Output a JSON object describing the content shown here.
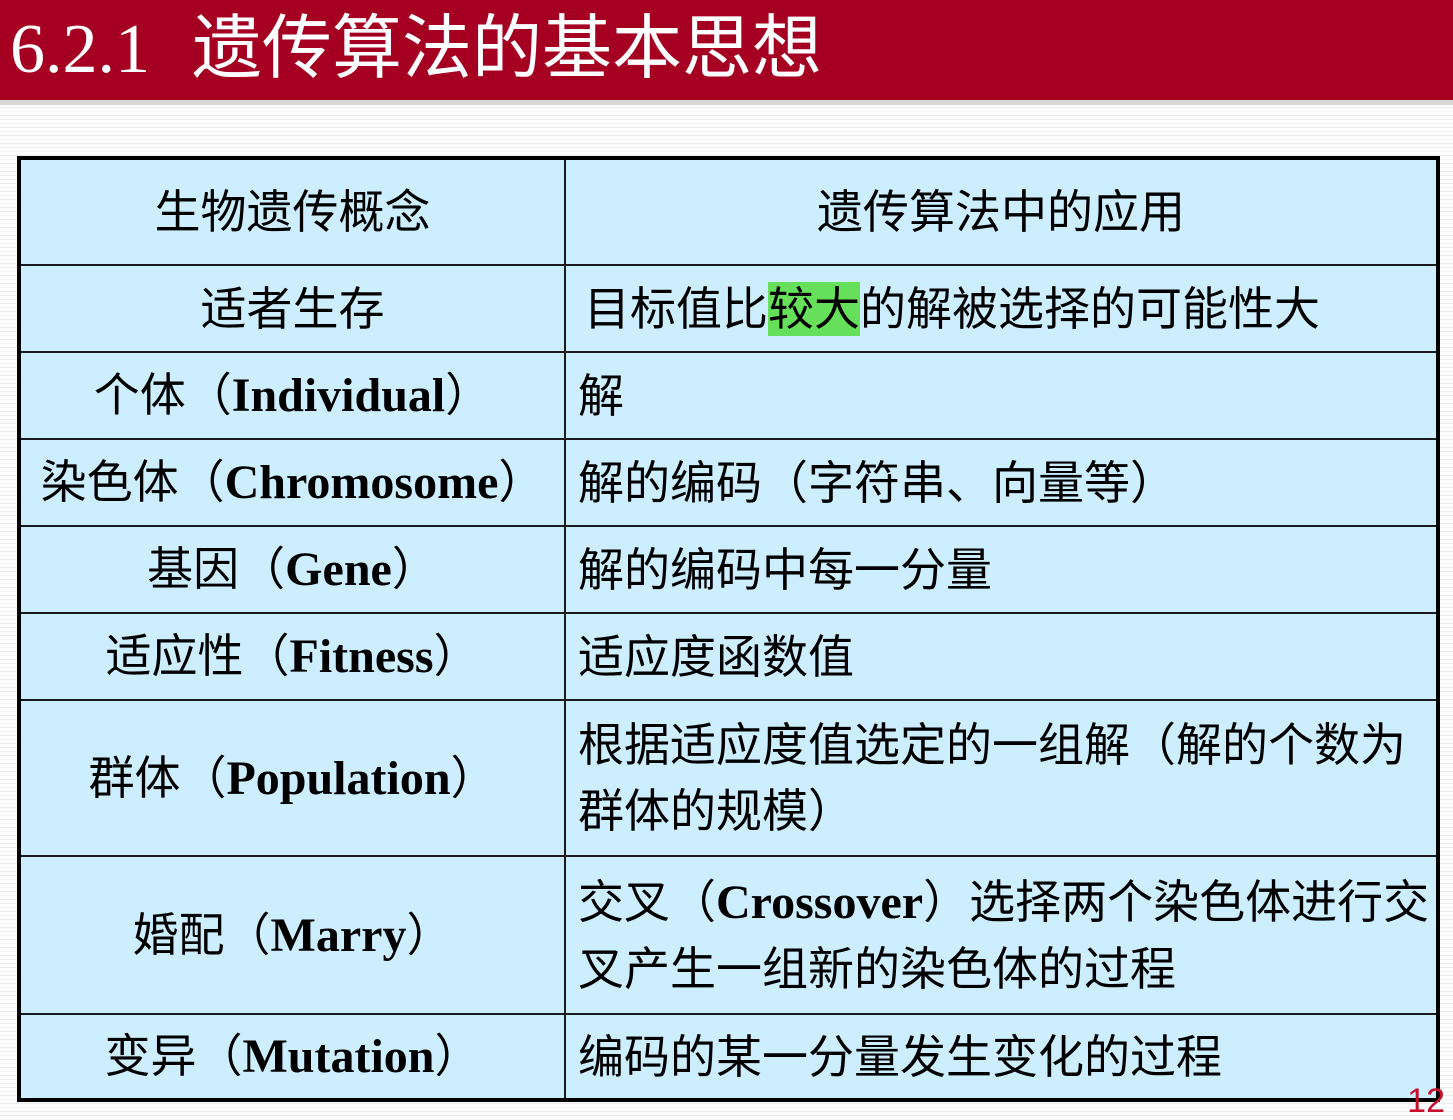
{
  "title": {
    "number": "6.2.1",
    "text": "遗传算法的基本思想"
  },
  "table": {
    "headers": [
      "生物遗传概念",
      "遗传算法中的应用"
    ],
    "rows": [
      {
        "concept_cn": "适者生存",
        "concept_en": "",
        "application_pre": "目标值比",
        "application_highlight": "较大",
        "application_post": "的解被选择的可能性大"
      },
      {
        "concept_cn": "个体（",
        "concept_en": "Individual",
        "concept_close": "）",
        "application": "解"
      },
      {
        "concept_cn": "染色体（",
        "concept_en": "Chromosome",
        "concept_close": "）",
        "application": "解的编码（字符串、向量等）"
      },
      {
        "concept_cn": "基因（",
        "concept_en": "Gene",
        "concept_close": "）",
        "application": "解的编码中每一分量"
      },
      {
        "concept_cn": "适应性（",
        "concept_en": "Fitness",
        "concept_close": "）",
        "application": "适应度函数值"
      },
      {
        "concept_cn": "群体（",
        "concept_en": "Population",
        "concept_close": "）",
        "application": "根据适应度值选定的一组解（解的个数为群体的规模）"
      },
      {
        "concept_cn": "婚配（",
        "concept_en": "Marry",
        "concept_close": "）",
        "application_pre": "交叉（",
        "application_en": "Crossover",
        "application_post": "）选择两个染色体进行交叉产生一组新的染色体的过程"
      },
      {
        "concept_cn": "变异（",
        "concept_en": "Mutation",
        "concept_close": "）",
        "application": "编码的某一分量发生变化的过程"
      }
    ]
  },
  "page_number": "12",
  "colors": {
    "title_bar": "#a50021",
    "table_bg": "#cdeeff",
    "highlight": "#66e05a",
    "page_number": "#c8102e"
  }
}
